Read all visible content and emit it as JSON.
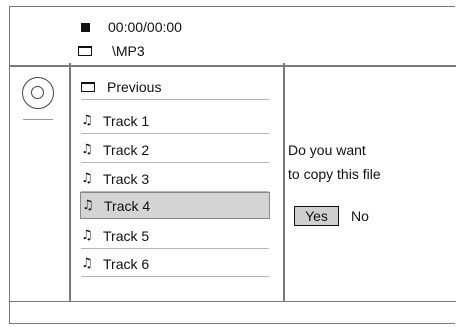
{
  "header": {
    "time": "00:00/00:00",
    "path": "\\MP3"
  },
  "file_list": {
    "items": [
      {
        "label": "Previous",
        "icon": "folder-icon",
        "selected": false
      },
      {
        "label": "Track 1",
        "icon": "music-note-icon",
        "selected": false
      },
      {
        "label": "Track 2",
        "icon": "music-note-icon",
        "selected": false
      },
      {
        "label": "Track 3",
        "icon": "music-note-icon",
        "selected": false
      },
      {
        "label": "Track 4",
        "icon": "music-note-icon",
        "selected": true
      },
      {
        "label": "Track 5",
        "icon": "music-note-icon",
        "selected": false
      },
      {
        "label": "Track 6",
        "icon": "music-note-icon",
        "selected": false
      }
    ]
  },
  "dialog": {
    "line1": "Do you want",
    "line2": "to copy this file",
    "yes_label": "Yes",
    "no_label": "No"
  },
  "colors": {
    "frame": "#7a7a7a",
    "selected_bg": "#d4d4d4"
  }
}
